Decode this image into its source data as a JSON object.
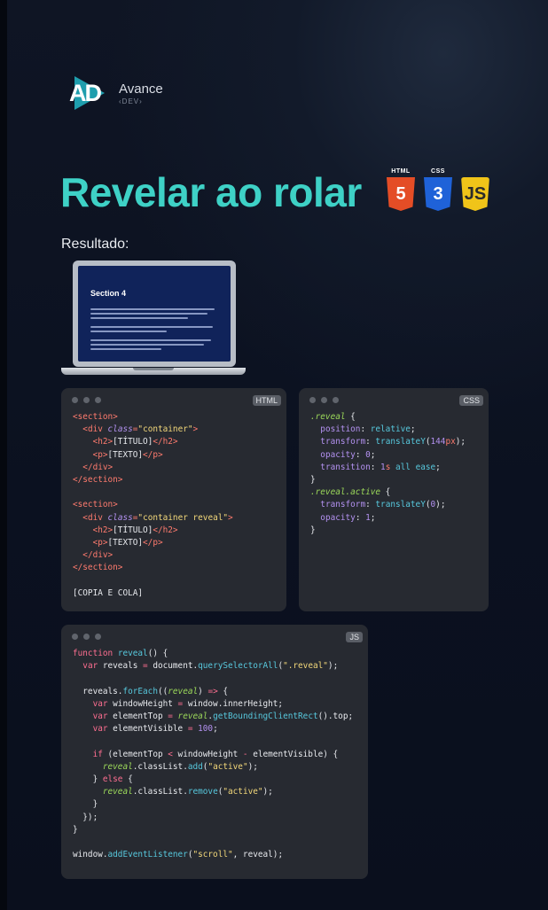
{
  "brand": {
    "mark": "AD",
    "name": "Avance",
    "tag": "‹DEV›"
  },
  "headline": "Revelar ao rolar",
  "tech": [
    {
      "caption": "HTML",
      "glyph": "5",
      "icon": "html5-shield-icon",
      "color": "#e44d26"
    },
    {
      "caption": "CSS",
      "glyph": "3",
      "icon": "css3-shield-icon",
      "color": "#1f62d8"
    },
    {
      "caption": "",
      "glyph": "JS",
      "icon": "javascript-shield-icon",
      "color": "#f0c419"
    }
  ],
  "result_label": "Resultado:",
  "preview": {
    "section_title": "Section 4"
  },
  "html_card": {
    "badge": "HTML",
    "lines": [
      [
        [
          "tag",
          "<section>"
        ]
      ],
      [
        [
          "pl",
          "  "
        ],
        [
          "tag",
          "<div "
        ],
        [
          "attr",
          "class"
        ],
        [
          "tag",
          "="
        ],
        [
          "str",
          "\"container\""
        ],
        [
          "tag",
          ">"
        ]
      ],
      [
        [
          "pl",
          "    "
        ],
        [
          "tag",
          "<h2>"
        ],
        [
          "txt",
          "[TÍTULO]"
        ],
        [
          "tag",
          "</h2>"
        ]
      ],
      [
        [
          "pl",
          "    "
        ],
        [
          "tag",
          "<p>"
        ],
        [
          "txt",
          "[TEXTO]"
        ],
        [
          "tag",
          "</p>"
        ]
      ],
      [
        [
          "pl",
          "  "
        ],
        [
          "tag",
          "</div>"
        ]
      ],
      [
        [
          "tag",
          "</section>"
        ]
      ],
      [],
      [
        [
          "tag",
          "<section>"
        ]
      ],
      [
        [
          "pl",
          "  "
        ],
        [
          "tag",
          "<div "
        ],
        [
          "attr",
          "class"
        ],
        [
          "tag",
          "="
        ],
        [
          "str",
          "\"container reveal\""
        ],
        [
          "tag",
          ">"
        ]
      ],
      [
        [
          "pl",
          "    "
        ],
        [
          "tag",
          "<h2>"
        ],
        [
          "txt",
          "[TÍTULO]"
        ],
        [
          "tag",
          "</h2>"
        ]
      ],
      [
        [
          "pl",
          "    "
        ],
        [
          "tag",
          "<p>"
        ],
        [
          "txt",
          "[TEXTO]"
        ],
        [
          "tag",
          "</p>"
        ]
      ],
      [
        [
          "pl",
          "  "
        ],
        [
          "tag",
          "</div>"
        ]
      ],
      [
        [
          "tag",
          "</section>"
        ]
      ],
      [],
      [
        [
          "txt",
          "[COPIA E COLA]"
        ]
      ]
    ]
  },
  "css_card": {
    "badge": "CSS",
    "lines": [
      [
        [
          "sel",
          ".reveal"
        ],
        [
          "pl",
          " {"
        ]
      ],
      [
        [
          "pl",
          "  "
        ],
        [
          "prop",
          "position"
        ],
        [
          "pl",
          ": "
        ],
        [
          "fn",
          "relative"
        ],
        [
          "pl",
          ";"
        ]
      ],
      [
        [
          "pl",
          "  "
        ],
        [
          "prop",
          "transform"
        ],
        [
          "pl",
          ": "
        ],
        [
          "fn",
          "translateY"
        ],
        [
          "pl",
          "("
        ],
        [
          "num",
          "144"
        ],
        [
          "unit",
          "px"
        ],
        [
          "pl",
          ");"
        ]
      ],
      [
        [
          "pl",
          "  "
        ],
        [
          "prop",
          "opacity"
        ],
        [
          "pl",
          ": "
        ],
        [
          "num",
          "0"
        ],
        [
          "pl",
          ";"
        ]
      ],
      [
        [
          "pl",
          "  "
        ],
        [
          "prop",
          "transition"
        ],
        [
          "pl",
          ": "
        ],
        [
          "num",
          "1"
        ],
        [
          "unit",
          "s"
        ],
        [
          "pl",
          " "
        ],
        [
          "fn",
          "all ease"
        ],
        [
          "pl",
          ";"
        ]
      ],
      [
        [
          "pl",
          "}"
        ]
      ],
      [
        [
          "sel",
          ".reveal.active"
        ],
        [
          "pl",
          " {"
        ]
      ],
      [
        [
          "pl",
          "  "
        ],
        [
          "prop",
          "transform"
        ],
        [
          "pl",
          ": "
        ],
        [
          "fn",
          "translateY"
        ],
        [
          "pl",
          "("
        ],
        [
          "num",
          "0"
        ],
        [
          "pl",
          ");"
        ]
      ],
      [
        [
          "pl",
          "  "
        ],
        [
          "prop",
          "opacity"
        ],
        [
          "pl",
          ": "
        ],
        [
          "num",
          "1"
        ],
        [
          "pl",
          ";"
        ]
      ],
      [
        [
          "pl",
          "}"
        ]
      ]
    ]
  },
  "js_card": {
    "badge": "JS",
    "lines": [
      [
        [
          "kw",
          "function "
        ],
        [
          "fn",
          "reveal"
        ],
        [
          "pl",
          "() {"
        ]
      ],
      [
        [
          "pl",
          "  "
        ],
        [
          "kw",
          "var "
        ],
        [
          "pl",
          "reveals "
        ],
        [
          "op",
          "= "
        ],
        [
          "pl",
          "document."
        ],
        [
          "fn",
          "querySelectorAll"
        ],
        [
          "pl",
          "("
        ],
        [
          "str",
          "\".reveal\""
        ],
        [
          "pl",
          ");"
        ]
      ],
      [],
      [
        [
          "pl",
          "  reveals."
        ],
        [
          "fn",
          "forEach"
        ],
        [
          "pl",
          "(("
        ],
        [
          "var",
          "reveal"
        ],
        [
          "pl",
          ") "
        ],
        [
          "op",
          "=>"
        ],
        [
          "pl",
          " {"
        ]
      ],
      [
        [
          "pl",
          "    "
        ],
        [
          "kw",
          "var "
        ],
        [
          "pl",
          "windowHeight "
        ],
        [
          "op",
          "= "
        ],
        [
          "pl",
          "window.innerHeight;"
        ]
      ],
      [
        [
          "pl",
          "    "
        ],
        [
          "kw",
          "var "
        ],
        [
          "pl",
          "elementTop "
        ],
        [
          "op",
          "= "
        ],
        [
          "var",
          "reveal"
        ],
        [
          "pl",
          "."
        ],
        [
          "fn",
          "getBoundingClientRect"
        ],
        [
          "pl",
          "().top;"
        ]
      ],
      [
        [
          "pl",
          "    "
        ],
        [
          "kw",
          "var "
        ],
        [
          "pl",
          "elementVisible "
        ],
        [
          "op",
          "= "
        ],
        [
          "num",
          "100"
        ],
        [
          "pl",
          ";"
        ]
      ],
      [],
      [
        [
          "pl",
          "    "
        ],
        [
          "kw",
          "if "
        ],
        [
          "pl",
          "(elementTop "
        ],
        [
          "op",
          "< "
        ],
        [
          "pl",
          "windowHeight "
        ],
        [
          "op",
          "- "
        ],
        [
          "pl",
          "elementVisible) {"
        ]
      ],
      [
        [
          "pl",
          "      "
        ],
        [
          "var",
          "reveal"
        ],
        [
          "pl",
          ".classList."
        ],
        [
          "fn",
          "add"
        ],
        [
          "pl",
          "("
        ],
        [
          "str",
          "\"active\""
        ],
        [
          "pl",
          ");"
        ]
      ],
      [
        [
          "pl",
          "    } "
        ],
        [
          "kw",
          "else "
        ],
        [
          "pl",
          "{"
        ]
      ],
      [
        [
          "pl",
          "      "
        ],
        [
          "var",
          "reveal"
        ],
        [
          "pl",
          ".classList."
        ],
        [
          "fn",
          "remove"
        ],
        [
          "pl",
          "("
        ],
        [
          "str",
          "\"active\""
        ],
        [
          "pl",
          ");"
        ]
      ],
      [
        [
          "pl",
          "    }"
        ]
      ],
      [
        [
          "pl",
          "  });"
        ]
      ],
      [
        [
          "pl",
          "}"
        ]
      ],
      [],
      [
        [
          "pl",
          "window."
        ],
        [
          "fn",
          "addEventListener"
        ],
        [
          "pl",
          "("
        ],
        [
          "str",
          "\"scroll\""
        ],
        [
          "pl",
          ", reveal);"
        ]
      ]
    ]
  }
}
